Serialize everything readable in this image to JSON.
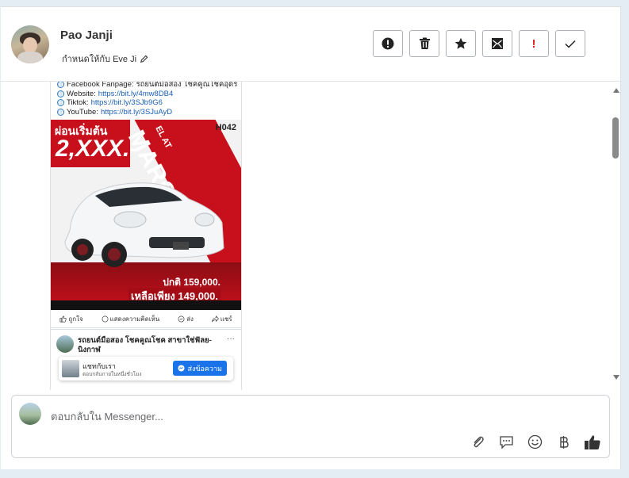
{
  "contact": {
    "name": "Pao Janji",
    "assigned_to": "กำหนดให้กับ Eve Ji"
  },
  "toolbar": {
    "buttons": [
      {
        "name": "alert-icon"
      },
      {
        "name": "trash-icon"
      },
      {
        "name": "star-icon"
      },
      {
        "name": "mark-unread-icon"
      },
      {
        "name": "important-icon",
        "label": "!"
      },
      {
        "name": "check-icon"
      }
    ]
  },
  "message": {
    "links": [
      {
        "label": "Facebook Fanpage: ",
        "value": "รถยนต์มือสอง โชคคูณโชคอุดร"
      },
      {
        "label": "Website: ",
        "value": "https://bit.ly/4mw8DB4"
      },
      {
        "label": "Tiktok: ",
        "value": "https://bit.ly/3SJb9G6"
      },
      {
        "label": "YouTube: ",
        "value": "https://bit.ly/3SJuAyD"
      }
    ],
    "post": {
      "installment_label": "ผ่อนเริ่มต้น",
      "installment_price": "2,XXX.-",
      "code": "H042",
      "model": "MARCH 1.2",
      "trim": "EL AT",
      "normal_price": "ปกติ 159,000.",
      "sale_price": "เหลือเพียง 149,000."
    },
    "actions": {
      "like": "ถูกใจ",
      "comment": "แสดงความคิดเห็น",
      "send": "ส่ง",
      "share": "แชร์"
    },
    "second_post": {
      "page_name": "รถยนต์มือสอง โชคคูณโชค สาขาใช่ฟัลย-นิงกาฬ",
      "more": "···",
      "chat_title": "แชทกับเรา",
      "chat_subtitle": "ตอบกลับภายในหนึ่งชั่วโมง",
      "chat_button": "ส่งข้อความ"
    }
  },
  "reply": {
    "placeholder": "ตอบกลับใน Messenger...",
    "icons": [
      "paperclip-icon",
      "comment-icon",
      "emoji-icon",
      "baht-icon",
      "thumbs-up-icon"
    ]
  },
  "colors": {
    "accent_red": "#c8101c",
    "messenger_blue": "#1a73e8",
    "link_blue": "#1a5fb4"
  }
}
